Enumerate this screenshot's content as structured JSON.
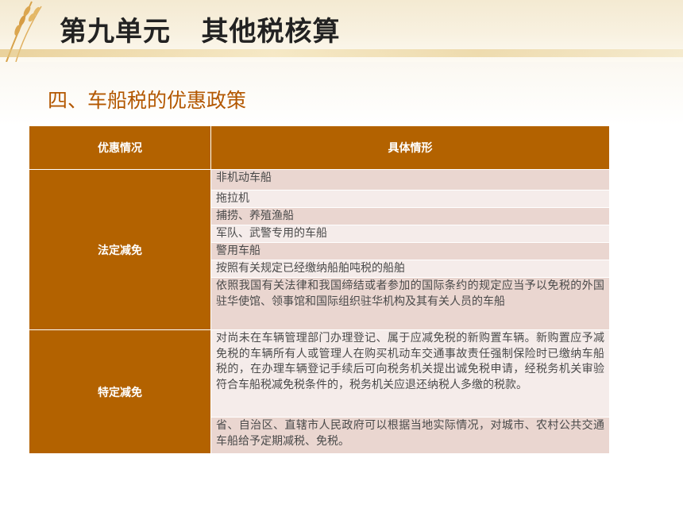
{
  "header": {
    "title": "第九单元   其他税核算",
    "icon": "wheat-icon"
  },
  "section": {
    "subtitle": "四、车船税的优惠政策"
  },
  "table": {
    "columns": [
      "优惠情况",
      "具体情形"
    ],
    "groups": [
      {
        "category": "法定减免",
        "items": [
          "非机动车船",
          "拖拉机",
          "捕捞、养殖渔船",
          "军队、武警专用的车船",
          "警用车船",
          "按照有关规定已经缴纳船舶吨税的船舶",
          "依照我国有关法律和我国缔结或者参加的国际条约的规定应当予以免税的外国驻华使馆、领事馆和国际组织驻华机构及其有关人员的车船"
        ]
      },
      {
        "category": "特定减免",
        "items": [
          "对尚未在车辆管理部门办理登记、属于应减免税的新购置车辆。新购置应予减免税的车辆所有人或管理人在购买机动车交通事故责任强制保险时已缴纳车船税的，在办理车辆登记手续后可向税务机关提出诚免税申请，经税务机关审验符合车船税减免税条件的，税务机关应退还纳税人多缴的税款。",
          "省、自治区、直辖市人民政府可以根据当地实际情况，对城市、农村公共交通车船给予定期减税、免税。"
        ]
      }
    ]
  },
  "colors": {
    "accent": "#b36200",
    "row_dark": "#ead6d0",
    "row_light": "#f5ecea",
    "subtitle": "#b35700"
  }
}
